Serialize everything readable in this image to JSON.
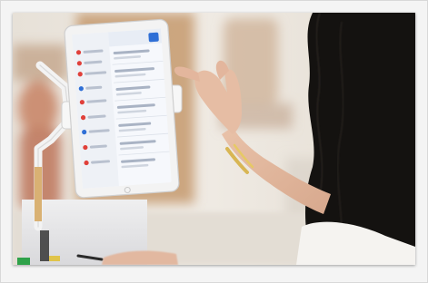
{
  "scene": {
    "subject": "woman-using-tablet-on-stand",
    "device": "tablet",
    "device_orientation": "portrait",
    "screen_ui": "list-app",
    "colors": {
      "frame": "#f4f4f4",
      "background_wall": "#ece6de",
      "wood": "#c99a6b",
      "hair": "#141210",
      "skin": "#e2b8a0",
      "bracelet": "#d8b654",
      "tablet_body": "#f2f2f2",
      "tablet_screen": "#f5f7fb",
      "accent_blue": "#2f6fd6",
      "accent_red": "#e0403a"
    }
  }
}
